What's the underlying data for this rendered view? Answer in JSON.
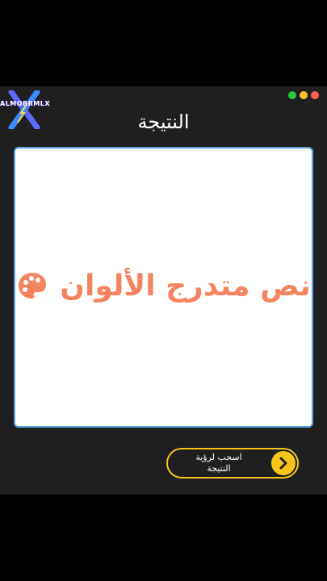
{
  "logo": {
    "text": "ALMOBRMLX",
    "icon": "x-logo-icon"
  },
  "window_controls": {
    "colors": [
      "#ff5f57",
      "#febc2e",
      "#28c840"
    ]
  },
  "title": "النتيجة",
  "result": {
    "text": "نص متدرج الألوان",
    "icon": "palette-icon",
    "color": "#f4845f"
  },
  "swipe": {
    "label_line1": "اسحب لرؤية",
    "label_line2": "النتيجة",
    "icon": "chevron-right-icon",
    "accent": "#f5c518"
  }
}
